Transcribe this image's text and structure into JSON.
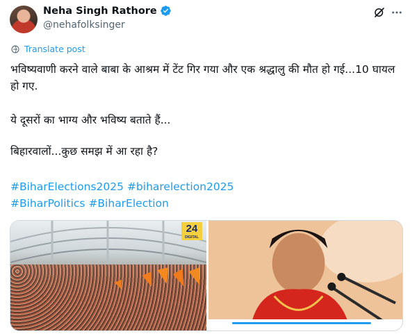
{
  "author": {
    "display_name": "Neha Singh Rathore",
    "handle": "@nehafolksinger",
    "verified": true
  },
  "actions": {
    "grok_icon": "grok-icon",
    "more_icon": "more-icon"
  },
  "translate": {
    "label": "Translate post",
    "icon": "globe-translate-icon"
  },
  "post": {
    "paragraph_1": "भविष्यवाणी करने वाले बाबा के आश्रम में टेंट गिर गया और एक श्रद्धालु की मौत हो गई...10 घायल हो गए.",
    "paragraph_2": "ये दूसरों का भाग्य और भविष्य बताते हैं...",
    "paragraph_3": "बिहारवालों...कुछ समझ में आ रहा है?",
    "hashtags": [
      "#BiharElections2025",
      "#biharelection2025",
      "#BiharPolitics",
      "#BiharElection"
    ]
  },
  "media": {
    "left_badge": "24",
    "left_badge_sub": "DIGITAL"
  },
  "colors": {
    "accent": "#1d9bf0",
    "text": "#0f1419",
    "secondary": "#536471"
  }
}
